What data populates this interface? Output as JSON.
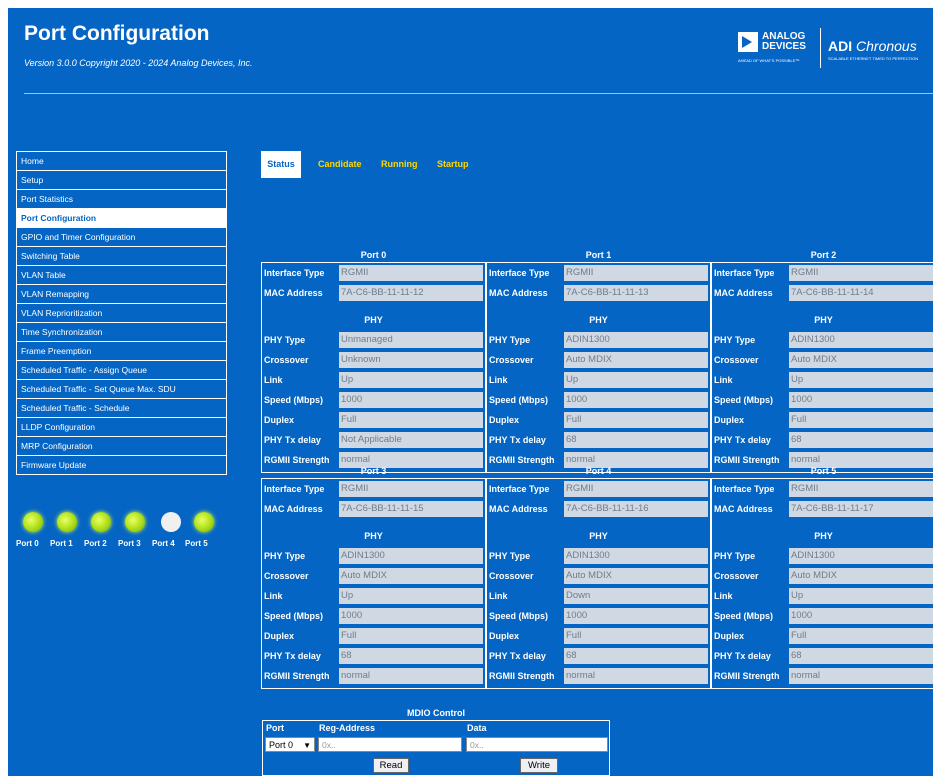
{
  "header": {
    "title": "Port Configuration",
    "version": "Version 3.0.0 Copyright 2020 - 2024 Analog Devices, Inc.",
    "logo_analog_line1": "ANALOG",
    "logo_analog_line2": "DEVICES",
    "logo_analog_tagline": "AHEAD OF WHAT'S POSSIBLE™",
    "logo_chronous_brand": "ADI",
    "logo_chronous_name": "Chronous",
    "logo_chronous_tagline": "SCALABLE ETHERNET TIMED TO PERFECTION"
  },
  "nav": {
    "items": [
      {
        "label": "Home"
      },
      {
        "label": "Setup"
      },
      {
        "label": "Port Statistics"
      },
      {
        "label": "Port Configuration",
        "active": true
      },
      {
        "label": "GPIO and Timer Configuration"
      },
      {
        "label": "Switching Table"
      },
      {
        "label": "VLAN Table"
      },
      {
        "label": "VLAN Remapping"
      },
      {
        "label": "VLAN Reprioritization"
      },
      {
        "label": "Time Synchronization"
      },
      {
        "label": "Frame Preemption"
      },
      {
        "label": "Scheduled Traffic - Assign Queue"
      },
      {
        "label": "Scheduled Traffic - Set Queue Max. SDU"
      },
      {
        "label": "Scheduled Traffic - Schedule"
      },
      {
        "label": "LLDP Configuration"
      },
      {
        "label": "MRP Configuration"
      },
      {
        "label": "Firmware Update"
      }
    ]
  },
  "leds": [
    {
      "label": "Port 0",
      "state": "on"
    },
    {
      "label": "Port 1",
      "state": "on"
    },
    {
      "label": "Port 2",
      "state": "on"
    },
    {
      "label": "Port 3",
      "state": "on"
    },
    {
      "label": "Port 4",
      "state": "off"
    },
    {
      "label": "Port 5",
      "state": "on"
    }
  ],
  "tabs": [
    {
      "label": "Status",
      "active": true
    },
    {
      "label": "Candidate"
    },
    {
      "label": "Running"
    },
    {
      "label": "Startup"
    }
  ],
  "labels": {
    "interface_type": "Interface Type",
    "mac_address": "MAC Address",
    "phy_heading": "PHY",
    "phy_type": "PHY Type",
    "crossover": "Crossover",
    "link": "Link",
    "speed": "Speed (Mbps)",
    "duplex": "Duplex",
    "phy_tx_delay": "PHY Tx delay",
    "rgmii_strength": "RGMII Strength"
  },
  "ports": [
    {
      "title": "Port 0",
      "interface_type": "RGMII",
      "mac_address": "7A-C6-BB-11-11-12",
      "phy_type": "Unmanaged",
      "crossover": "Unknown",
      "link": "Up",
      "speed": "1000",
      "duplex": "Full",
      "phy_tx_delay": "Not Applicable",
      "rgmii_strength": "normal"
    },
    {
      "title": "Port 1",
      "interface_type": "RGMII",
      "mac_address": "7A-C6-BB-11-11-13",
      "phy_type": "ADIN1300",
      "crossover": "Auto MDIX",
      "link": "Up",
      "speed": "1000",
      "duplex": "Full",
      "phy_tx_delay": "68",
      "rgmii_strength": "normal"
    },
    {
      "title": "Port 2",
      "interface_type": "RGMII",
      "mac_address": "7A-C6-BB-11-11-14",
      "phy_type": "ADIN1300",
      "crossover": "Auto MDIX",
      "link": "Up",
      "speed": "1000",
      "duplex": "Full",
      "phy_tx_delay": "68",
      "rgmii_strength": "normal"
    },
    {
      "title": "Port 3",
      "interface_type": "RGMII",
      "mac_address": "7A-C6-BB-11-11-15",
      "phy_type": "ADIN1300",
      "crossover": "Auto MDIX",
      "link": "Up",
      "speed": "1000",
      "duplex": "Full",
      "phy_tx_delay": "68",
      "rgmii_strength": "normal"
    },
    {
      "title": "Port 4",
      "interface_type": "RGMII",
      "mac_address": "7A-C6-BB-11-11-16",
      "phy_type": "ADIN1300",
      "crossover": "Auto MDIX",
      "link": "Down",
      "speed": "1000",
      "duplex": "Full",
      "phy_tx_delay": "68",
      "rgmii_strength": "normal"
    },
    {
      "title": "Port 5",
      "interface_type": "RGMII",
      "mac_address": "7A-C6-BB-11-11-17",
      "phy_type": "ADIN1300",
      "crossover": "Auto MDIX",
      "link": "Up",
      "speed": "1000",
      "duplex": "Full",
      "phy_tx_delay": "68",
      "rgmii_strength": "normal"
    }
  ],
  "mdio": {
    "title": "MDIO Control",
    "port_header": "Port",
    "reg_header": "Reg-Address",
    "data_header": "Data",
    "port_value": "Port 0",
    "reg_placeholder": "0x..",
    "data_placeholder": "0x..",
    "read_label": "Read",
    "write_label": "Write"
  },
  "colors": {
    "background": "#0565c4",
    "tab_link": "#ffd700",
    "field_bg": "#cfd8e3",
    "field_text": "#6f7d8b"
  }
}
